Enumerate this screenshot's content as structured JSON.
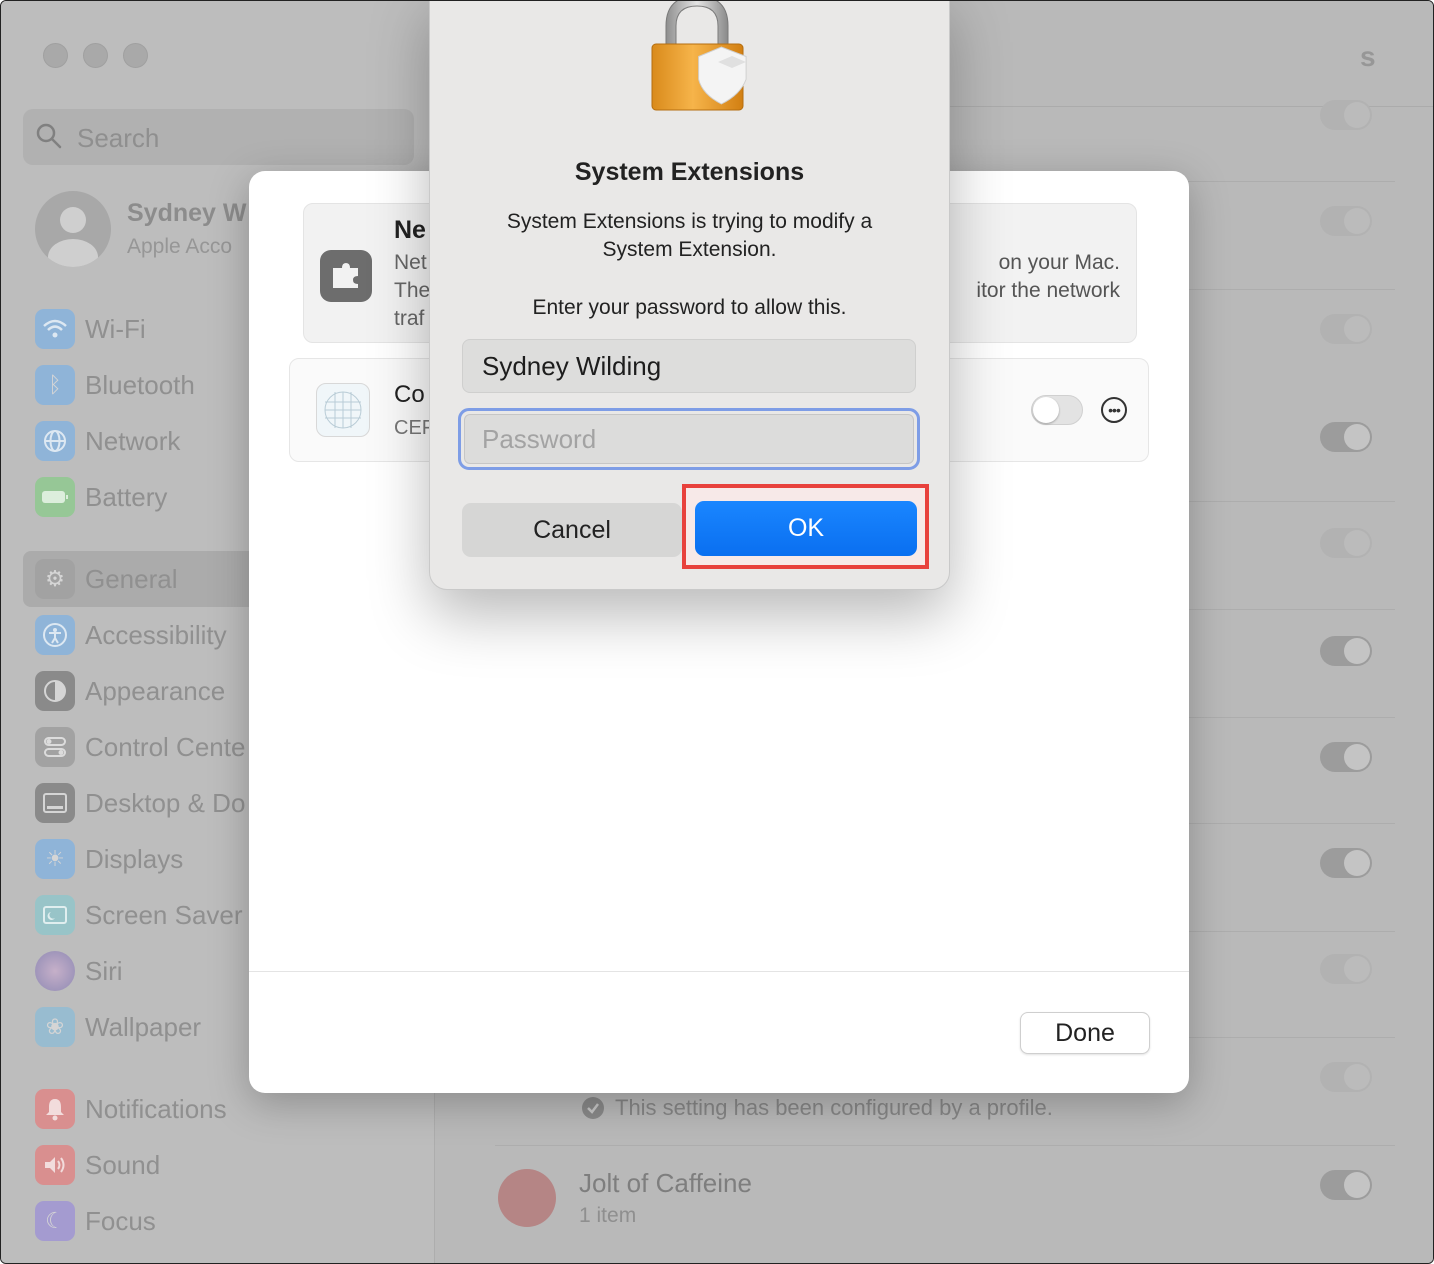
{
  "window": {
    "title_fragment": "s"
  },
  "sidebar": {
    "search_placeholder": "Search",
    "account": {
      "name": "Sydney W",
      "subtitle": "Apple Acco"
    },
    "items": [
      {
        "label": "Wi-Fi",
        "icon": "wifi-icon",
        "color": "#8fb4d8"
      },
      {
        "label": "Bluetooth",
        "icon": "bluetooth-icon",
        "color": "#8fb4d8"
      },
      {
        "label": "Network",
        "icon": "globe-icon",
        "color": "#8fb4d8"
      },
      {
        "label": "Battery",
        "icon": "battery-icon",
        "color": "#96c796"
      },
      {
        "label": "General",
        "icon": "gear-icon",
        "color": "#a2a2a2",
        "selected": true
      },
      {
        "label": "Accessibility",
        "icon": "accessibility-icon",
        "color": "#8fb4d8"
      },
      {
        "label": "Appearance",
        "icon": "appearance-icon",
        "color": "#8a8a8a"
      },
      {
        "label": "Control Cente",
        "icon": "control-center-icon",
        "color": "#a2a2a2"
      },
      {
        "label": "Desktop & Do",
        "icon": "desktop-dock-icon",
        "color": "#8a8a8a"
      },
      {
        "label": "Displays",
        "icon": "sun-icon",
        "color": "#8fb4d8"
      },
      {
        "label": "Screen Saver",
        "icon": "screen-saver-icon",
        "color": "#98c4c8"
      },
      {
        "label": "Siri",
        "icon": "siri-icon",
        "color": "#a89bb8"
      },
      {
        "label": "Wallpaper",
        "icon": "flower-icon",
        "color": "#98bcd0"
      },
      {
        "label": "Notifications",
        "icon": "bell-icon",
        "color": "#d98f8f"
      },
      {
        "label": "Sound",
        "icon": "speaker-icon",
        "color": "#d98f8f"
      },
      {
        "label": "Focus",
        "icon": "moon-icon",
        "color": "#a49bd0"
      }
    ]
  },
  "background": {
    "profile_note": "This setting has been configured by a profile.",
    "jolt": {
      "name": "Jolt of Caffeine",
      "subtitle": "1 item"
    }
  },
  "sheet": {
    "info": {
      "title": "Ne",
      "line1": "Net",
      "line2": "The",
      "line3": "traf",
      "right1": "on your Mac.",
      "right2": "itor the network"
    },
    "extension": {
      "name": "Co",
      "subtitle": "CEF",
      "enabled": false
    },
    "done_label": "Done"
  },
  "dialog": {
    "title": "System Extensions",
    "message": "System Extensions is trying to modify a System Extension.",
    "prompt": "Enter your password to allow this.",
    "username": "Sydney Wilding",
    "password_placeholder": "Password",
    "cancel_label": "Cancel",
    "ok_label": "OK",
    "accent_color": "#0a7aff",
    "highlight_color": "#e8413c"
  }
}
